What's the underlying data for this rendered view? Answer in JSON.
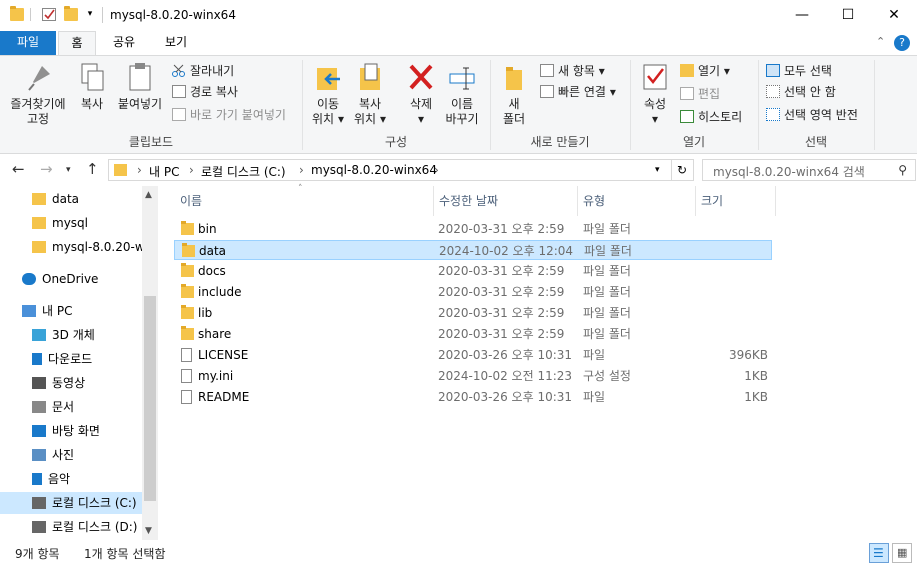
{
  "window": {
    "title": "mysql-8.0.20-winx64",
    "minimize": "—",
    "maximize": "☐",
    "close": "✕"
  },
  "ribbon_tabs": [
    "파일",
    "홈",
    "공유",
    "보기"
  ],
  "ribbon": {
    "clipboard": {
      "pin_l1": "즐겨찾기에",
      "pin_l2": "고정",
      "copy": "복사",
      "paste": "붙여넣기",
      "cut": "잘라내기",
      "copy_path": "경로 복사",
      "paste_shortcut": "바로 가기 붙여넣기",
      "label": "클립보드"
    },
    "organize": {
      "move_l1": "이동",
      "move_l2": "위치",
      "copyto_l1": "복사",
      "copyto_l2": "위치",
      "delete": "삭제",
      "rename_l1": "이름",
      "rename_l2": "바꾸기",
      "label": "구성"
    },
    "new": {
      "new_folder_l1": "새",
      "new_folder_l2": "폴더",
      "new_item": "새 항목",
      "easy_access": "빠른 연결",
      "label": "새로 만들기"
    },
    "open": {
      "properties": "속성",
      "open": "열기",
      "edit": "편집",
      "history": "히스토리",
      "label": "열기"
    },
    "select": {
      "select_all": "모두 선택",
      "select_none": "선택 안 함",
      "invert": "선택 영역 반전",
      "label": "선택"
    }
  },
  "address": {
    "crumbs": [
      "내 PC",
      "로컬 디스크 (C:)",
      "mysql-8.0.20-winx64"
    ],
    "search_placeholder": "mysql-8.0.20-winx64 검색"
  },
  "nav_pane": {
    "items": [
      {
        "label": "data",
        "icon": "folder-icon"
      },
      {
        "label": "mysql",
        "icon": "folder-icon"
      },
      {
        "label": "mysql-8.0.20-w",
        "icon": "folder-icon"
      },
      {
        "label": "OneDrive",
        "icon": "cloud-icon"
      },
      {
        "label": "내 PC",
        "icon": "pc-icon"
      },
      {
        "label": "3D 개체",
        "icon": "cube-icon"
      },
      {
        "label": "다운로드",
        "icon": "download-icon"
      },
      {
        "label": "동영상",
        "icon": "video-icon"
      },
      {
        "label": "문서",
        "icon": "document-icon"
      },
      {
        "label": "바탕 화면",
        "icon": "desktop-icon"
      },
      {
        "label": "사진",
        "icon": "picture-icon"
      },
      {
        "label": "음악",
        "icon": "music-icon"
      },
      {
        "label": "로컬 디스크 (C:)",
        "icon": "drive-icon",
        "selected": true
      },
      {
        "label": "로컬 디스크 (D:)",
        "icon": "drive-icon"
      }
    ]
  },
  "columns": [
    "이름",
    "수정한 날짜",
    "유형",
    "크기"
  ],
  "files": [
    {
      "name": "bin",
      "date": "2020-03-31 오후 2:59",
      "type": "파일 폴더",
      "size": "",
      "kind": "folder"
    },
    {
      "name": "data",
      "date": "2024-10-02 오후 12:04",
      "type": "파일 폴더",
      "size": "",
      "kind": "folder",
      "selected": true
    },
    {
      "name": "docs",
      "date": "2020-03-31 오후 2:59",
      "type": "파일 폴더",
      "size": "",
      "kind": "folder"
    },
    {
      "name": "include",
      "date": "2020-03-31 오후 2:59",
      "type": "파일 폴더",
      "size": "",
      "kind": "folder"
    },
    {
      "name": "lib",
      "date": "2020-03-31 오후 2:59",
      "type": "파일 폴더",
      "size": "",
      "kind": "folder"
    },
    {
      "name": "share",
      "date": "2020-03-31 오후 2:59",
      "type": "파일 폴더",
      "size": "",
      "kind": "folder"
    },
    {
      "name": "LICENSE",
      "date": "2020-03-26 오후 10:31",
      "type": "파일",
      "size": "396KB",
      "kind": "file"
    },
    {
      "name": "my.ini",
      "date": "2024-10-02 오전 11:23",
      "type": "구성 설정",
      "size": "1KB",
      "kind": "config"
    },
    {
      "name": "README",
      "date": "2020-03-26 오후 10:31",
      "type": "파일",
      "size": "1KB",
      "kind": "file"
    }
  ],
  "status": {
    "count": "9개 항목",
    "selected": "1개 항목 선택함"
  },
  "colors": {
    "accent": "#1979ca",
    "selection": "#cce8ff",
    "folder": "#f5c44a"
  }
}
